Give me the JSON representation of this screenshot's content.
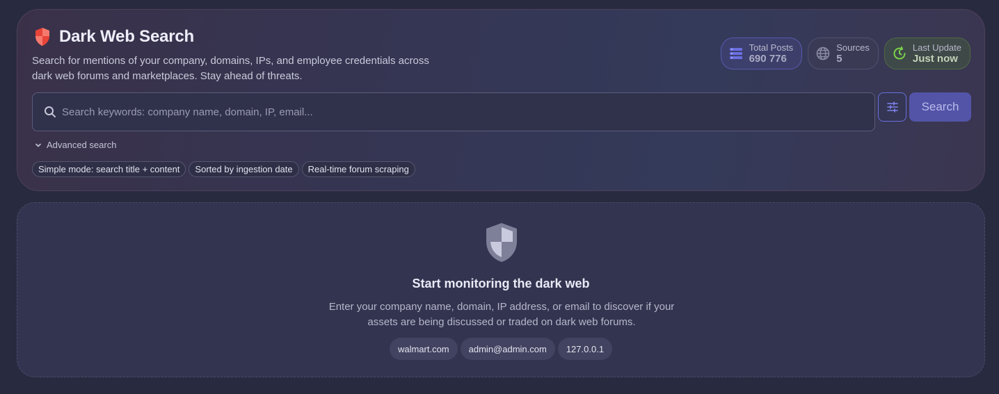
{
  "header": {
    "title": "Dark Web Search",
    "subtitle": "Search for mentions of your company, domains, IPs, and employee credentials across dark web forums and marketplaces. Stay ahead of threats."
  },
  "stats": {
    "total_posts": {
      "label": "Total Posts",
      "value": "690 776"
    },
    "sources": {
      "label": "Sources",
      "value": "5"
    },
    "last_update": {
      "label": "Last Update",
      "value": "Just now"
    }
  },
  "search": {
    "placeholder": "Search keywords: company name, domain, IP, email...",
    "value": "",
    "button_label": "Search",
    "advanced_label": "Advanced search"
  },
  "chips": [
    "Simple mode: search title + content",
    "Sorted by ingestion date",
    "Real-time forum scraping"
  ],
  "empty_state": {
    "title": "Start monitoring the dark web",
    "description": "Enter your company name, domain, IP address, or email to discover if your assets are being discussed or traded on dark web forums.",
    "examples": [
      "walmart.com",
      "admin@admin.com",
      "127.0.0.1"
    ]
  },
  "colors": {
    "accent": "#6a6fe0",
    "brand_shield": "#e8443a",
    "update_green": "#7bd24a"
  },
  "icons": {
    "title": "shield-icon",
    "posts": "database-icon",
    "sources": "globe-icon",
    "update": "refresh-clock-icon",
    "search": "search-icon",
    "filter": "sliders-icon",
    "advanced": "chevron-down-icon",
    "empty": "shield-icon"
  }
}
